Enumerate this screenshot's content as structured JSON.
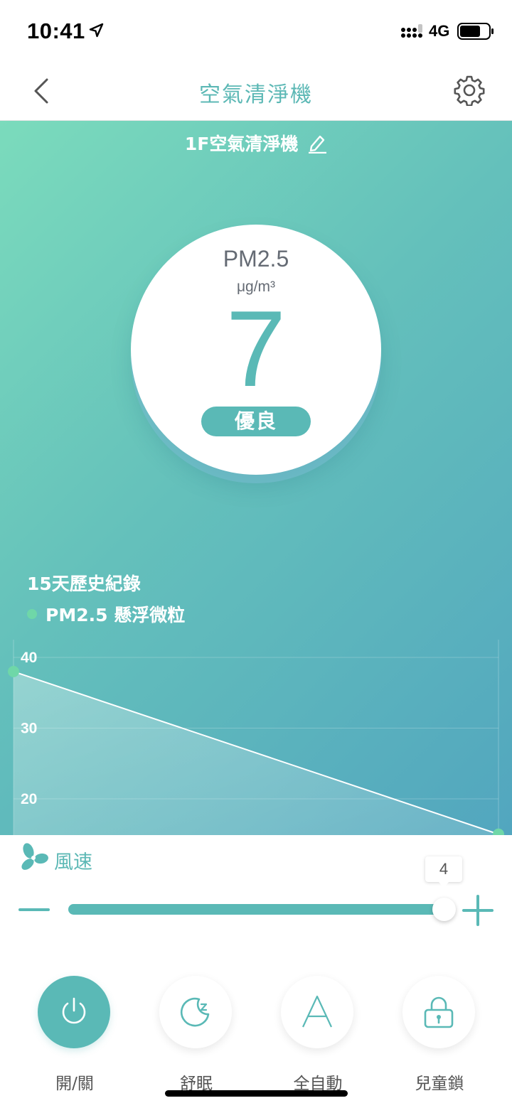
{
  "status_bar": {
    "time": "10:41",
    "network": "4G"
  },
  "nav": {
    "title": "空氣清淨機"
  },
  "device": {
    "name": "1F空氣清淨機"
  },
  "gauge": {
    "title": "PM2.5",
    "unit": "μg/m³",
    "value": "7",
    "quality": "優良"
  },
  "history": {
    "title": "15天歷史紀錄",
    "legend": "PM2.5 懸浮微粒"
  },
  "chart_data": {
    "type": "area",
    "x": [
      0,
      1
    ],
    "series": [
      {
        "name": "PM2.5 懸浮微粒",
        "values": [
          38,
          15
        ]
      }
    ],
    "y_ticks": [
      "40",
      "30",
      "20"
    ],
    "ylim": [
      15,
      40
    ],
    "grid": true,
    "colors": {
      "line": "#ffffff",
      "point": "#6fd7a8"
    }
  },
  "fan": {
    "label": "風速",
    "value": 4,
    "min": 0,
    "max": 4,
    "display": "4"
  },
  "controls": [
    {
      "label": "開/關",
      "icon": "power-icon",
      "active": true
    },
    {
      "label": "舒眠",
      "icon": "sleep-icon",
      "active": false
    },
    {
      "label": "全自動",
      "icon": "auto-icon",
      "active": false
    },
    {
      "label": "兒童鎖",
      "icon": "lock-icon",
      "active": false
    }
  ],
  "colors": {
    "accent": "#5ab9b6",
    "gradient_start": "#7bdbbc",
    "gradient_end": "#52a6bf"
  }
}
